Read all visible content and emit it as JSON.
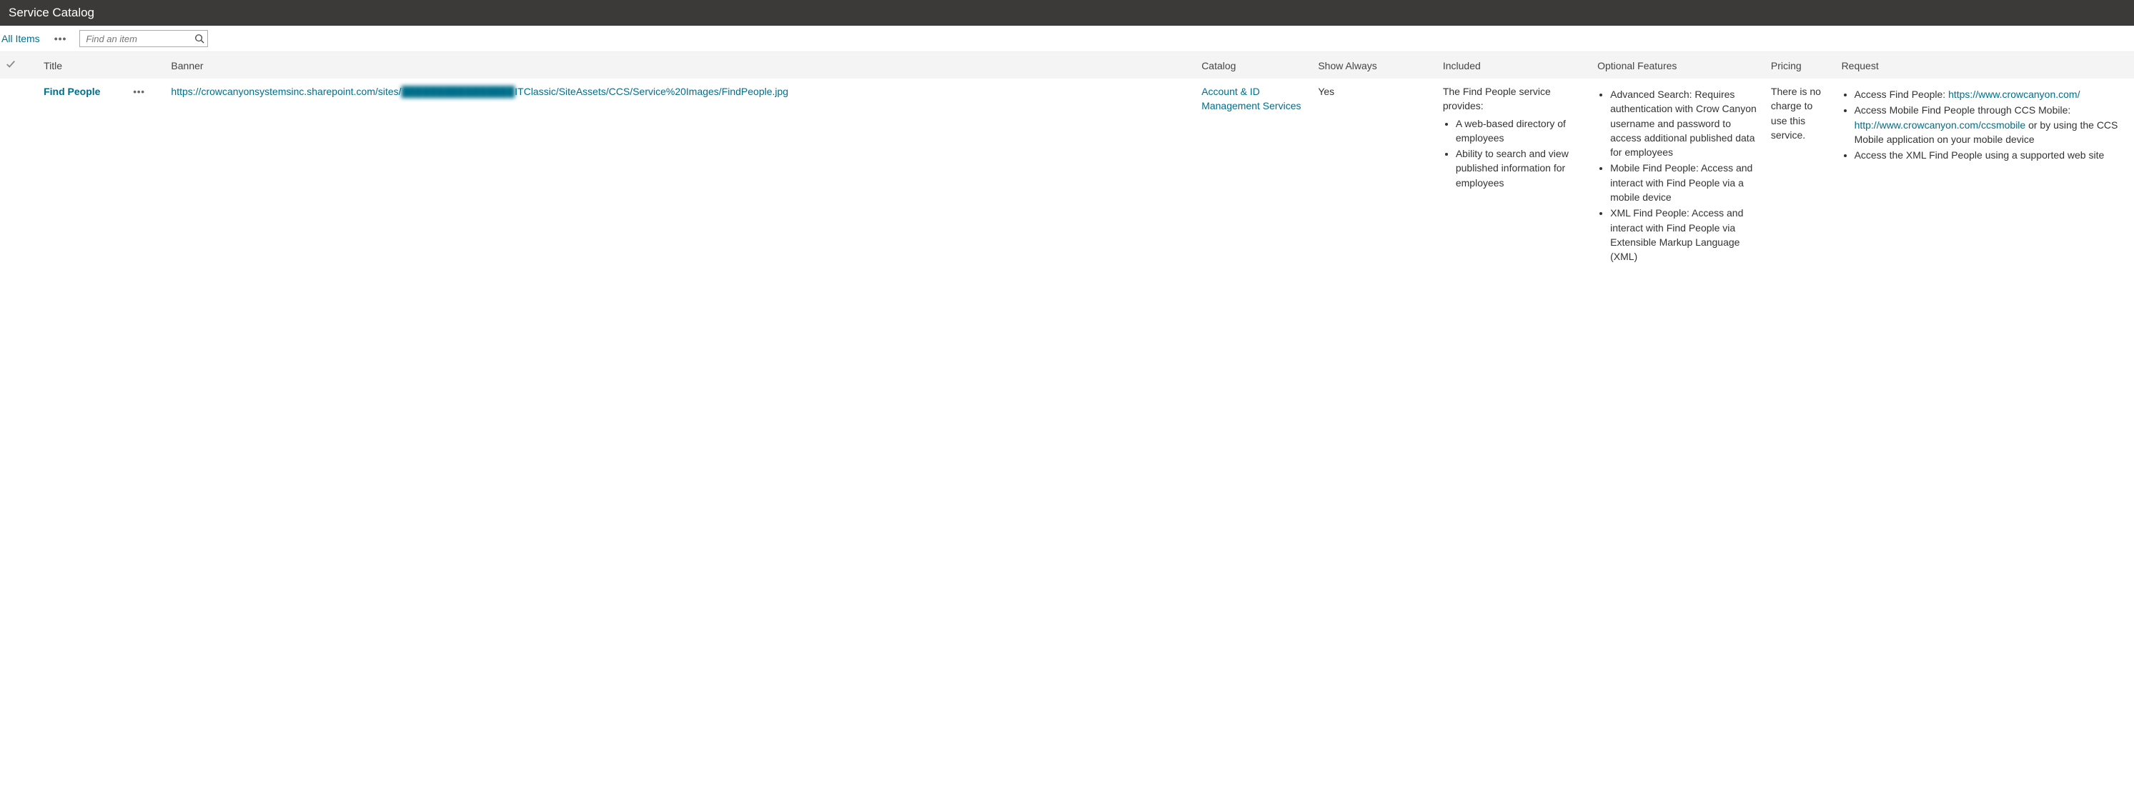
{
  "header": {
    "title": "Service Catalog"
  },
  "toolbar": {
    "view_label": "All Items",
    "search_placeholder": "Find an item"
  },
  "columns": {
    "title": "Title",
    "banner": "Banner",
    "catalog": "Catalog",
    "show_always": "Show Always",
    "included": "Included",
    "optional": "Optional Features",
    "pricing": "Pricing",
    "request": "Request"
  },
  "row": {
    "title": "Find People",
    "banner_pre": "https://crowcanyonsystemsinc.sharepoint.com/sites/",
    "banner_blur": "████████████████",
    "banner_post": "ITClassic/SiteAssets/CCS/Service%20Images/FindPeople.jpg",
    "catalog": "Account & ID Management Services",
    "show_always": "Yes",
    "included_intro": "The Find People service provides:",
    "included_items": [
      "A web-based directory of employees",
      "Ability to search and view published information for employees"
    ],
    "optional_items": [
      "Advanced Search: Requires authentication with Crow Canyon username and password to access additional published data for employees",
      "Mobile Find People: Access and interact with Find People via a mobile device",
      "XML Find People: Access and interact with Find People via Extensible Markup Language (XML)"
    ],
    "pricing": "There is no charge to use this service.",
    "request_items": [
      {
        "pre": "Access Find People: ",
        "link": "https://www.crowcanyon.com/",
        "post": ""
      },
      {
        "pre": "Access Mobile Find People through CCS Mobile: ",
        "link": "http://www.crowcanyon.com/ccsmobile",
        "post": " or by using the CCS Mobile application on your mobile device"
      },
      {
        "pre": "Access the XML Find People using a supported web site",
        "link": "",
        "post": ""
      }
    ]
  }
}
